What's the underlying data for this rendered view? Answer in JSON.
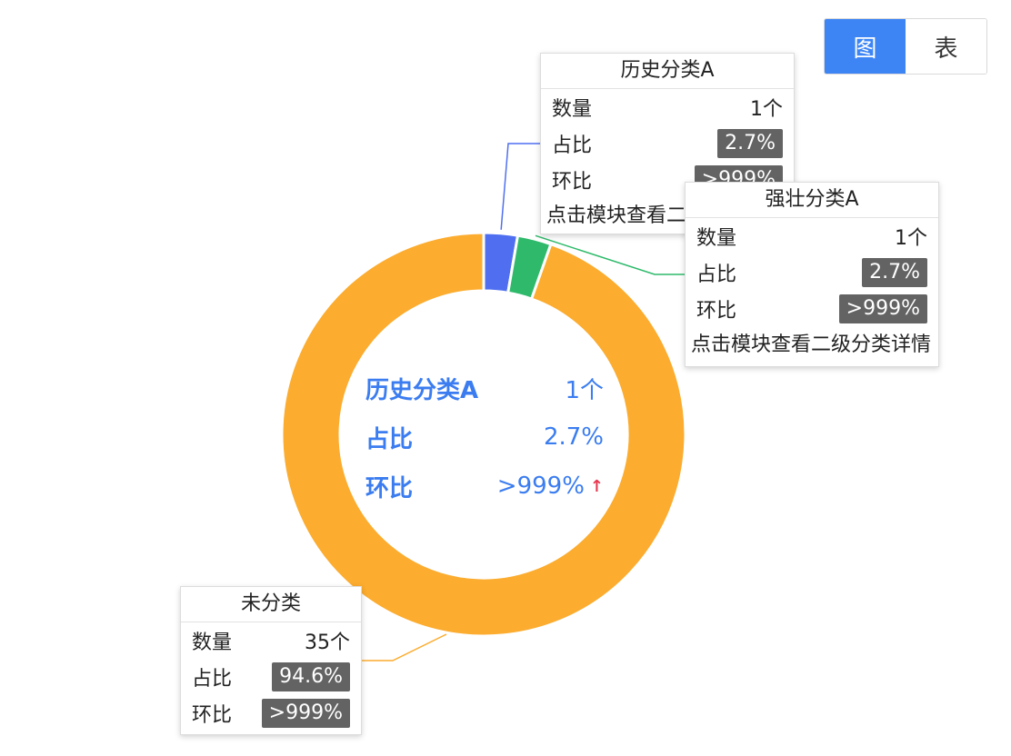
{
  "toggle": {
    "chart_label": "图",
    "table_label": "表",
    "active": "chart"
  },
  "center": {
    "name": "历史分类A",
    "count": "1个",
    "ratio_label": "占比",
    "ratio": "2.7%",
    "mom_label": "环比",
    "mom": ">999%",
    "mom_trend": "up"
  },
  "labels": [
    {
      "name": "历史分类A",
      "count_label": "数量",
      "count": "1个",
      "ratio_label": "占比",
      "ratio": "2.7%",
      "mom_label": "环比",
      "mom": ">999%",
      "hint": "点击模块查看二"
    },
    {
      "name": "强壮分类A",
      "count_label": "数量",
      "count": "1个",
      "ratio_label": "占比",
      "ratio": "2.7%",
      "mom_label": "环比",
      "mom": ">999%",
      "hint": "点击模块查看二级分类详情"
    },
    {
      "name": "未分类",
      "count_label": "数量",
      "count": "35个",
      "ratio_label": "占比",
      "ratio": "94.6%",
      "mom_label": "环比",
      "mom": ">999%"
    }
  ],
  "chart_data": {
    "type": "pie",
    "donut": true,
    "categories": [
      "历史分类A",
      "强壮分类A",
      "未分类"
    ],
    "values": [
      1,
      1,
      35
    ],
    "percentages": [
      2.7,
      2.7,
      94.6
    ],
    "colors": [
      "#4f6ff0",
      "#2fba6b",
      "#fcac2e"
    ]
  }
}
